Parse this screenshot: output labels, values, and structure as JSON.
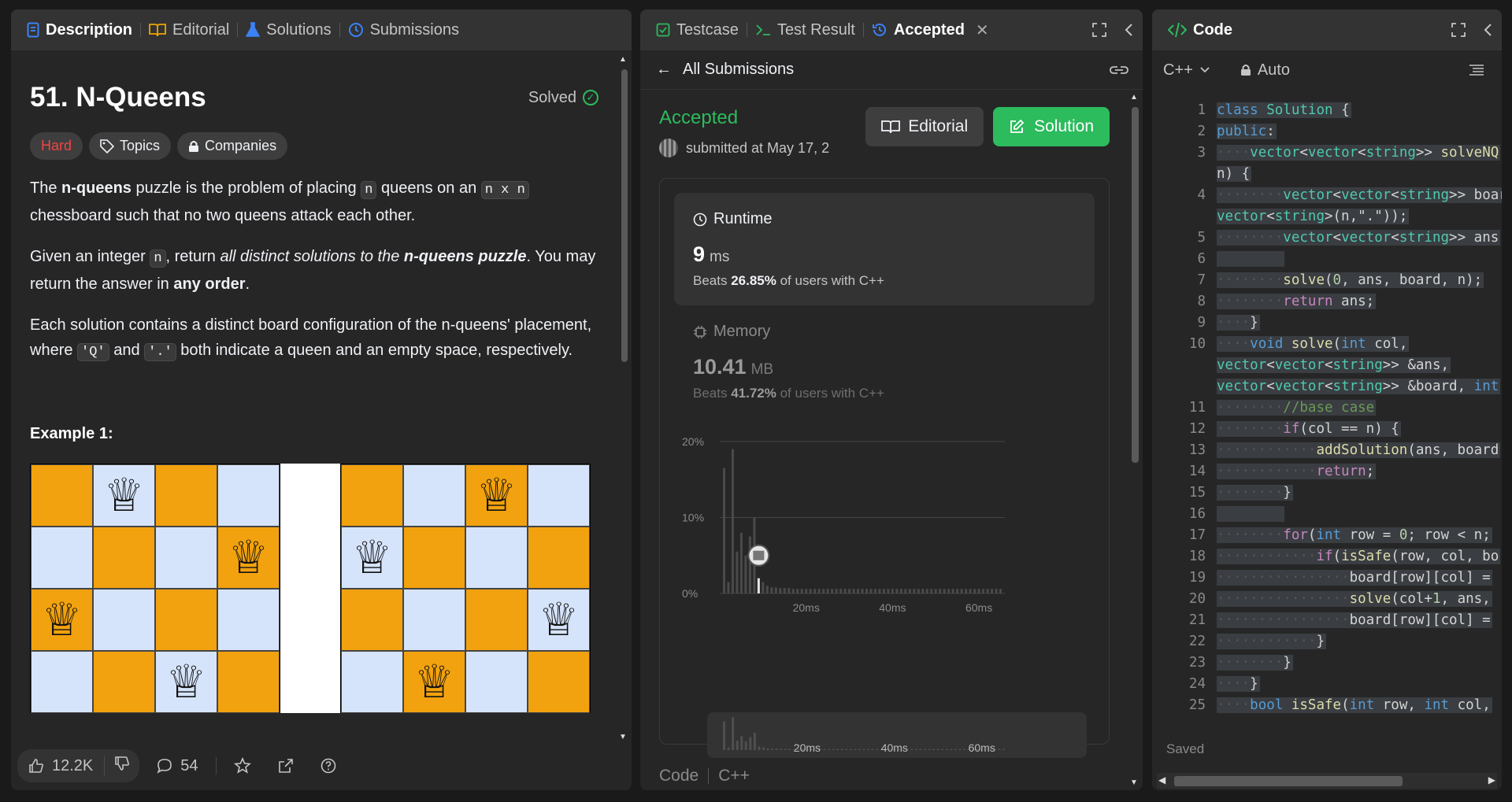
{
  "left": {
    "tabs": [
      "Description",
      "Editorial",
      "Solutions",
      "Submissions"
    ],
    "problem_title": "51. N-Queens",
    "status": "Solved",
    "tags": [
      "Hard",
      "Topics",
      "Companies"
    ],
    "p1": {
      "a": "The ",
      "b": "n-queens",
      "c": " puzzle is the problem of placing ",
      "code1": "n",
      "d": " queens on an ",
      "code2": "n x n",
      "e": " chessboard such that no two queens attack each other."
    },
    "p2": {
      "a": "Given an integer ",
      "code": "n",
      "b": ", return ",
      "c": "all distinct solutions to the ",
      "d": "n-queens puzzle",
      "e": ". You may return the answer in ",
      "f": "any order",
      "g": "."
    },
    "p3": {
      "a": "Each solution contains a distinct board configuration of the n-queens' placement, where ",
      "code1": "'Q'",
      "b": " and ",
      "code2": "'.'",
      "c": " both indicate a queen and an empty space, respectively."
    },
    "example_heading": "Example 1:",
    "likes": "12.2K",
    "comments": "54",
    "queen_glyph": "♕"
  },
  "mid": {
    "tabs": [
      "Testcase",
      "Test Result",
      "Accepted"
    ],
    "back_label": "All Submissions",
    "result": "Accepted",
    "submitted_text": "submitted at May 17, 2",
    "editorial_btn": "Editorial",
    "solution_btn": "Solution",
    "runtime": {
      "label": "Runtime",
      "value": "9",
      "unit": "ms",
      "beats_prefix": "Beats ",
      "beats_pct": "26.85%",
      "beats_suffix": " of users with C++"
    },
    "memory": {
      "label": "Memory",
      "value": "10.41",
      "unit": "MB",
      "beats_prefix": "Beats ",
      "beats_pct": "41.72%",
      "beats_suffix": " of users with C++"
    },
    "footer_code": "Code",
    "footer_lang": "C++"
  },
  "chart_data": {
    "type": "bar",
    "title": "",
    "ylabel": "",
    "y_ticks": [
      "20%",
      "10%",
      "0%"
    ],
    "x_ticks": [
      "20ms",
      "40ms",
      "60ms"
    ],
    "overview_x_ticks": [
      "20ms",
      "40ms",
      "60ms"
    ],
    "ylim": [
      0,
      20
    ],
    "xlim": [
      0,
      66
    ],
    "highlight_x": 9,
    "x": [
      1,
      2,
      3,
      4,
      5,
      6,
      7,
      8,
      9,
      10,
      11,
      12,
      13,
      14,
      15,
      16,
      17,
      18,
      19,
      20,
      21,
      22,
      23,
      24,
      25,
      26,
      27,
      28,
      29,
      30,
      31,
      32,
      33,
      34,
      35,
      36,
      37,
      38,
      39,
      40,
      41,
      42,
      43,
      44,
      45,
      46,
      47,
      48,
      49,
      50,
      51,
      52,
      53,
      54,
      55,
      56,
      57,
      58,
      59,
      60,
      61,
      62,
      63,
      64,
      65
    ],
    "values": [
      16.5,
      1.5,
      19,
      5.5,
      8,
      5,
      7.5,
      10,
      2,
      1.5,
      1,
      0.8,
      0.8,
      0.7,
      0.7,
      0.7,
      0.6,
      0.6,
      0.6,
      0.6,
      0.6,
      0.6,
      0.6,
      0.6,
      0.6,
      0.6,
      0.6,
      0.6,
      0.6,
      0.6,
      0.6,
      0.6,
      0.6,
      0.6,
      0.6,
      0.6,
      0.6,
      0.6,
      0.6,
      0.6,
      0.6,
      0.6,
      0.6,
      0.6,
      0.6,
      0.6,
      0.6,
      0.6,
      0.6,
      0.6,
      0.6,
      0.6,
      0.6,
      0.6,
      0.6,
      0.6,
      0.6,
      0.6,
      0.6,
      0.6,
      0.6,
      0.6,
      0.6,
      0.6,
      0.6
    ]
  },
  "right": {
    "title": "Code",
    "language": "C++",
    "mode": "Auto",
    "saved": "Saved",
    "lines": [
      {
        "n": "1",
        "t": "class Solution {"
      },
      {
        "n": "2",
        "t": "public:"
      },
      {
        "n": "3",
        "t": "····vector<vector<string>> solveNQ"
      },
      {
        "n": "",
        "t": "n) {"
      },
      {
        "n": "4",
        "t": "········vector<vector<string>> boar"
      },
      {
        "n": "",
        "t": "vector<string>(n,\".\"));"
      },
      {
        "n": "5",
        "t": "········vector<vector<string>> ans"
      },
      {
        "n": "6",
        "t": "        "
      },
      {
        "n": "7",
        "t": "········solve(0, ans, board, n);"
      },
      {
        "n": "8",
        "t": "········return ans;"
      },
      {
        "n": "9",
        "t": "····}"
      },
      {
        "n": "10",
        "t": "····void solve(int col,"
      },
      {
        "n": "",
        "t": "vector<vector<string>> &ans,"
      },
      {
        "n": "",
        "t": "vector<vector<string>> &board, int"
      },
      {
        "n": "11",
        "t": "········//base case"
      },
      {
        "n": "12",
        "t": "········if(col == n) {"
      },
      {
        "n": "13",
        "t": "············addSolution(ans, board"
      },
      {
        "n": "14",
        "t": "············return;"
      },
      {
        "n": "15",
        "t": "········}"
      },
      {
        "n": "16",
        "t": "        "
      },
      {
        "n": "17",
        "t": "········for(int row = 0; row < n;"
      },
      {
        "n": "18",
        "t": "············if(isSafe(row, col, bo"
      },
      {
        "n": "19",
        "t": "················board[row][col] ="
      },
      {
        "n": "20",
        "t": "················solve(col+1, ans,"
      },
      {
        "n": "21",
        "t": "················board[row][col] ="
      },
      {
        "n": "22",
        "t": "············}"
      },
      {
        "n": "23",
        "t": "········}"
      },
      {
        "n": "24",
        "t": "····}"
      },
      {
        "n": "25",
        "t": "····bool isSafe(int row, int col,"
      }
    ]
  }
}
